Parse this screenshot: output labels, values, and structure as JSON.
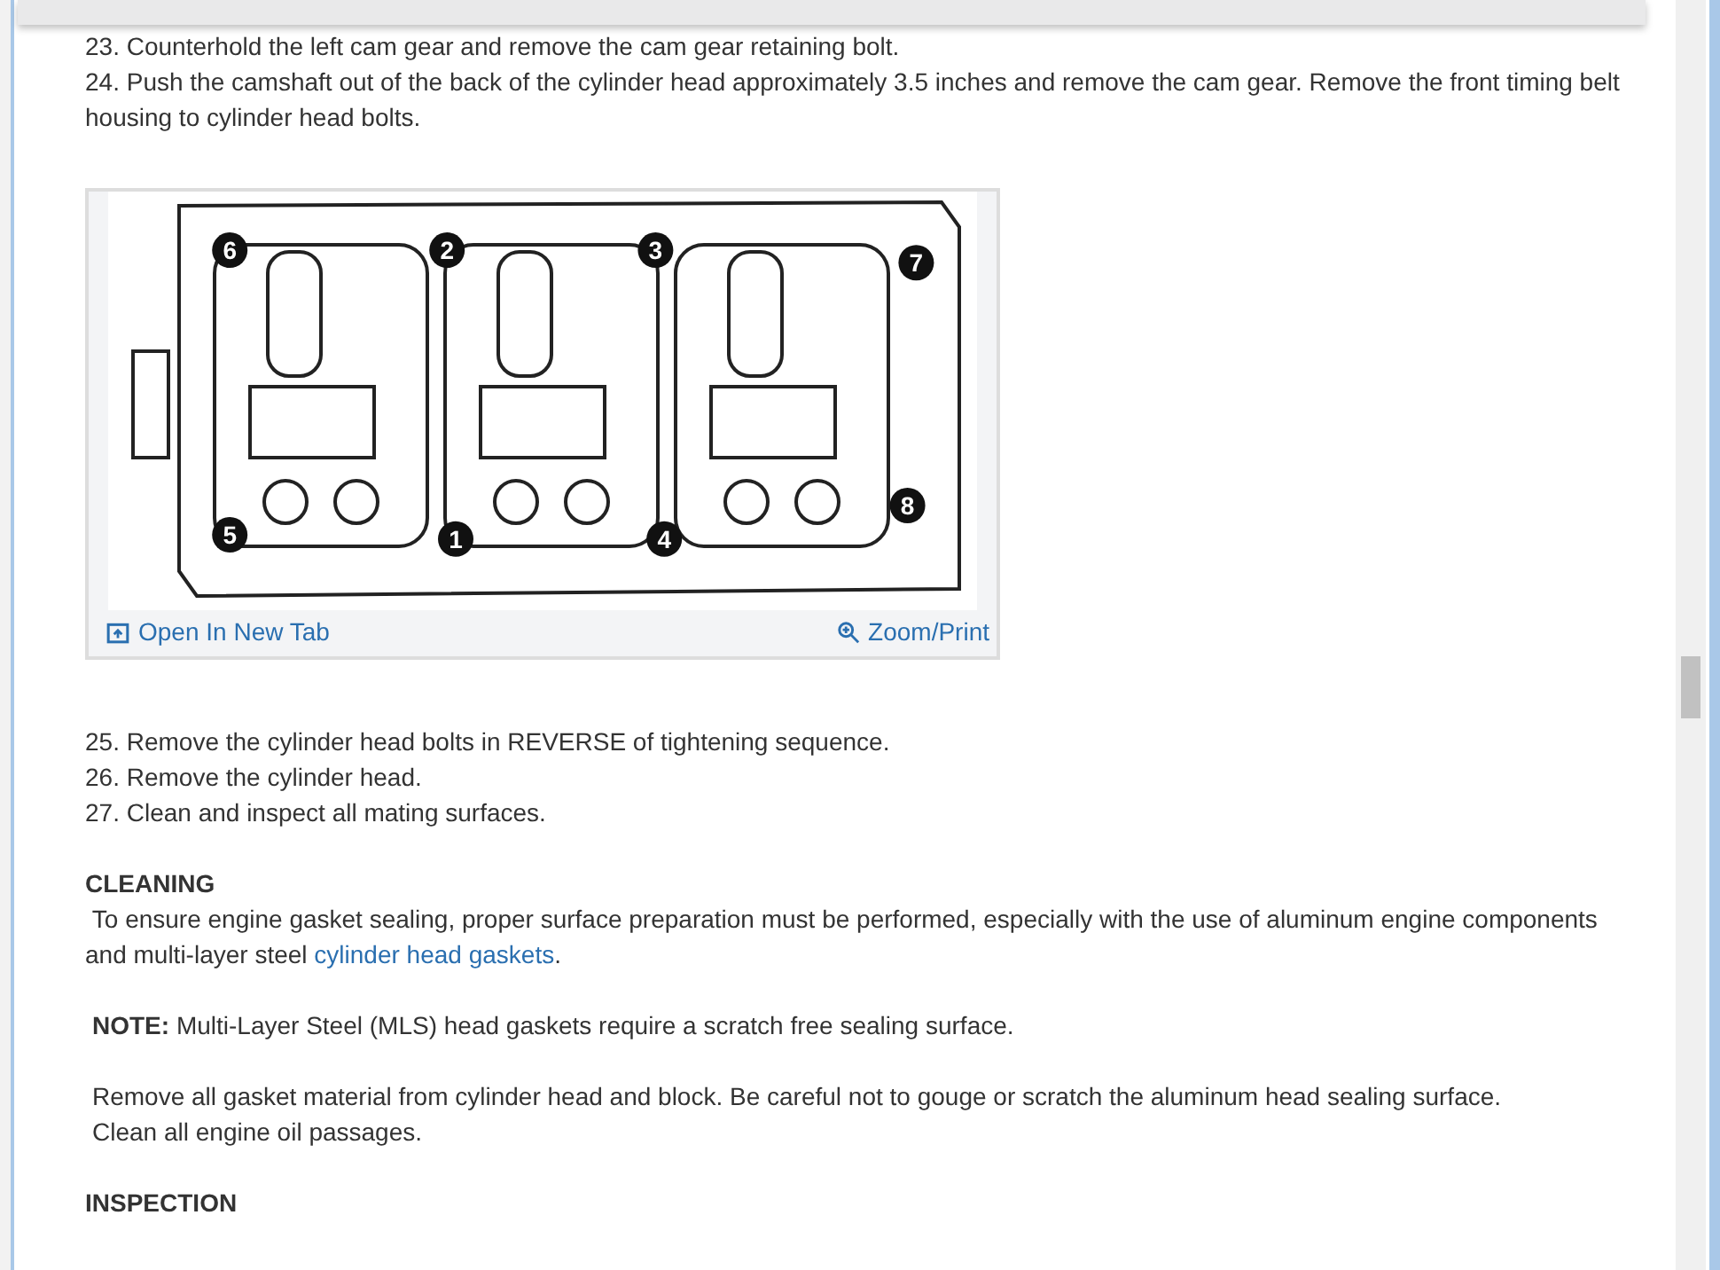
{
  "steps_top": [
    {
      "text": "23. Counterhold the left cam gear and remove the cam gear retaining bolt."
    },
    {
      "text": "24. Push the camshaft out of the back of the cylinder head approximately 3.5 inches and remove the cam gear. Remove the front timing belt housing to cylinder head bolts."
    }
  ],
  "figure": {
    "bolt_labels": [
      {
        "text": "6"
      },
      {
        "text": "2"
      },
      {
        "text": "3"
      },
      {
        "text": "7"
      },
      {
        "text": "5"
      },
      {
        "text": "1"
      },
      {
        "text": "4"
      },
      {
        "text": "8"
      }
    ],
    "open_link": "Open In New Tab",
    "zoom_link": "Zoom/Print"
  },
  "steps_bottom": [
    {
      "text": "25. Remove the cylinder head bolts in REVERSE of tightening sequence."
    },
    {
      "text": "26. Remove the cylinder head."
    },
    {
      "text": "27. Clean and inspect all mating surfaces."
    }
  ],
  "cleaning": {
    "heading": "CLEANING",
    "para": " To ensure engine gasket sealing, proper surface preparation must be performed, especially with the use of aluminum engine components and multi-layer steel ",
    "link": "cylinder head gaskets",
    "end": ".",
    "note": "**NOTE:** Multi-Layer Steel (MLS) head gaskets require a scratch free sealing surface.",
    "lines": [
      {
        "text": "Remove all gasket material from cylinder head and block. Be careful not to gouge or scratch the aluminum head sealing surface."
      },
      {
        "text": "Clean all engine oil passages."
      }
    ]
  },
  "inspection": {
    "heading": "INSPECTION"
  }
}
